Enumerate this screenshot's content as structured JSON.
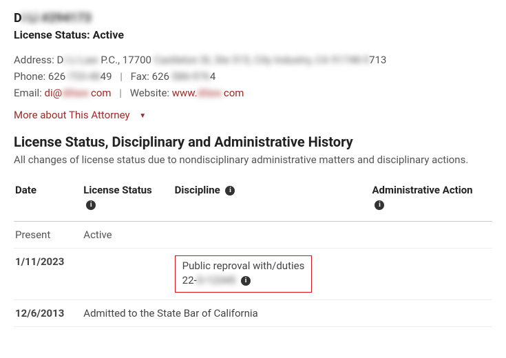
{
  "header": {
    "name_prefix": "D",
    "name_blurred": "i Li #294173",
    "status_label": "License Status:",
    "status_value": "Active"
  },
  "contact": {
    "address_label": "Address:",
    "address_prefix": "D",
    "address_firm_blurred": "i Li Law ",
    "address_mid": "P.C., 17700 ",
    "address_rest_blurred": "Castleton St, Ste 515, City Industry, CA 91748-5",
    "address_suffix": "713",
    "phone_label": "Phone:",
    "phone_prefix": "626",
    "phone_blurred": "-733-48",
    "phone_suffix": "49",
    "fax_label": "Fax:",
    "fax_prefix": "626",
    "fax_blurred": "-586-976",
    "fax_suffix": "4",
    "email_label": "Email:",
    "email_prefix": "di@",
    "email_blurred": "diliaw.",
    "email_suffix": "com",
    "website_label": "Website:",
    "website_prefix": "www.",
    "website_blurred": "dilaw.",
    "website_suffix": "com"
  },
  "more_link": "More about This Attorney",
  "section": {
    "title": "License Status, Disciplinary and Administrative History",
    "desc": "All changes of license status due to nondisciplinary administrative matters and disciplinary actions."
  },
  "table": {
    "headers": {
      "date": "Date",
      "status": "License Status",
      "discipline": "Discipline",
      "admin": "Administrative Action"
    },
    "rows": [
      {
        "date": "Present",
        "status": "Active",
        "discipline": "",
        "admin": ""
      },
      {
        "date": "1/11/2023",
        "status": "",
        "discipline_line1": "Public reproval with/duties",
        "discipline_caseprefix": "22-",
        "discipline_caseblur": "O-12345",
        "admin": "",
        "highlight": true
      },
      {
        "date": "12/6/2013",
        "status_span": "Admitted to the State Bar of California"
      }
    ]
  }
}
